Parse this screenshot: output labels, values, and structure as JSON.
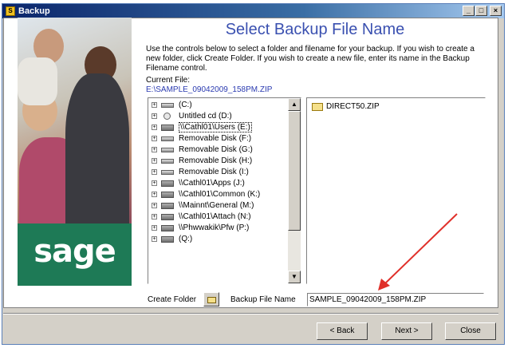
{
  "window": {
    "title": "Backup",
    "controls": [
      "_",
      "□",
      "×"
    ]
  },
  "brand": {
    "logo_text": "sage",
    "panel_color": "#1e7a56"
  },
  "heading": "Select Backup File Name",
  "instructions": "Use the controls below to select a folder and filename for your backup. If you wish to create a new folder, click Create Folder. If you wish to create a new file, enter its name in the Backup Filename control.",
  "current_file": {
    "label": "Current File:",
    "value": "E:\\SAMPLE_09042009_158PM.ZIP"
  },
  "folder_tree": {
    "items": [
      {
        "label": "(C:)",
        "icon": "drive-icon",
        "selected": false
      },
      {
        "label": "Untitled cd (D:)",
        "icon": "cd-icon",
        "selected": false
      },
      {
        "label": "\\\\Cathl01\\Users (E:)",
        "icon": "network-drive-icon",
        "selected": true
      },
      {
        "label": "Removable Disk (F:)",
        "icon": "drive-icon",
        "selected": false
      },
      {
        "label": "Removable Disk (G:)",
        "icon": "drive-icon",
        "selected": false
      },
      {
        "label": "Removable Disk (H:)",
        "icon": "drive-icon",
        "selected": false
      },
      {
        "label": "Removable Disk (I:)",
        "icon": "drive-icon",
        "selected": false
      },
      {
        "label": "\\\\Cathl01\\Apps (J:)",
        "icon": "network-drive-icon",
        "selected": false
      },
      {
        "label": "\\\\Cathl01\\Common (K:)",
        "icon": "network-drive-icon",
        "selected": false
      },
      {
        "label": "\\\\Mainnt\\General (M:)",
        "icon": "network-drive-icon",
        "selected": false
      },
      {
        "label": "\\\\Cathl01\\Attach (N:)",
        "icon": "network-drive-icon",
        "selected": false
      },
      {
        "label": "\\\\Phwwakik\\Pfw (P:)",
        "icon": "network-drive-icon",
        "selected": false
      },
      {
        "label": "(Q:)",
        "icon": "network-drive-icon",
        "selected": false
      }
    ]
  },
  "file_list": {
    "items": [
      {
        "name": "DIRECT50.ZIP",
        "icon": "zip-folder-icon"
      }
    ]
  },
  "bottom": {
    "create_folder_label": "Create Folder",
    "backup_file_name_label": "Backup File Name",
    "backup_file_name_value": "SAMPLE_09042009_158PM.ZIP"
  },
  "buttons": {
    "back": "< Back",
    "next": "Next >",
    "close": "Close"
  },
  "annotation_color": "#e0302a"
}
